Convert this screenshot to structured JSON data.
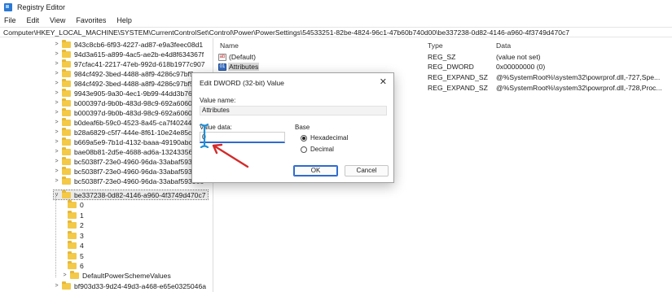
{
  "window": {
    "title": "Registry Editor"
  },
  "menu": {
    "items": [
      "File",
      "Edit",
      "View",
      "Favorites",
      "Help"
    ]
  },
  "address": {
    "path": "Computer\\HKEY_LOCAL_MACHINE\\SYSTEM\\CurrentControlSet\\Control\\Power\\PowerSettings\\54533251-82be-4824-96c1-47b60b740d00\\be337238-0d82-4146-a960-4f3749d470c7"
  },
  "tree": {
    "items": [
      "943c8cb6-6f93-4227-ad87-e9a3feec08d1",
      "94d3a615-a899-4ac5-ae2b-e4d8f634367f",
      "97cfac41-2217-47eb-992d-618b1977c907",
      "984cf492-3bed-4488-a8f9-4286c97bf5aa",
      "984cf492-3bed-4488-a8f9-4286c97bf5ab",
      "9943e905-9a30-4ec1-9b99-44dd3b76f7a",
      "b000397d-9b0b-483d-98c9-692a6060cfc",
      "b000397d-9b0b-483d-98c9-692a6060cfc",
      "b0deaf6b-59c0-4523-8a45-ca7f4024411",
      "b28a6829-c5f7-444e-8f61-10e24e85c532",
      "b669a5e9-7b1d-4132-baaa-49190abcfeb",
      "bae08b81-2d5e-4688-ad6a-13243356654",
      "bc5038f7-23e0-4960-96da-33abaf5935e",
      "bc5038f7-23e0-4960-96da-33abaf5935e",
      "bc5038f7-23e0-4960-96da-33abaf5935ee"
    ],
    "selected": "be337238-0d82-4146-a960-4f3749d470c7",
    "children": [
      "0",
      "1",
      "2",
      "3",
      "4",
      "5",
      "6",
      "DefaultPowerSchemeValues"
    ],
    "after": "bf903d33-9d24-49d3-a468-e65e0325046a"
  },
  "values": {
    "headers": {
      "name": "Name",
      "type": "Type",
      "data": "Data"
    },
    "rows": [
      {
        "name": "(Default)",
        "type": "REG_SZ",
        "data": "(value not set)",
        "icon": "string-value-icon"
      },
      {
        "name": "Attributes",
        "type": "REG_DWORD",
        "data": "0x00000000 (0)",
        "icon": "binary-value-icon"
      },
      {
        "name": "",
        "type": "REG_EXPAND_SZ",
        "data": "@%SystemRoot%\\system32\\powrprof.dll,-727,Spe...",
        "icon": ""
      },
      {
        "name": "",
        "type": "REG_EXPAND_SZ",
        "data": "@%SystemRoot%\\system32\\powrprof.dll,-728,Proc...",
        "icon": ""
      }
    ]
  },
  "dialog": {
    "title": "Edit DWORD (32-bit) Value",
    "value_name_label": "Value name:",
    "value_name": "Attributes",
    "value_data_label": "Value data:",
    "value_data": "0",
    "base_label": "Base",
    "hex_label": "Hexadecimal",
    "dec_label": "Decimal",
    "ok_label": "OK",
    "cancel_label": "Cancel",
    "close_glyph": "✕"
  },
  "colors": {
    "accent": "#2f6bd1",
    "arrow": "#d42a2a",
    "folder": "#f3c947"
  }
}
